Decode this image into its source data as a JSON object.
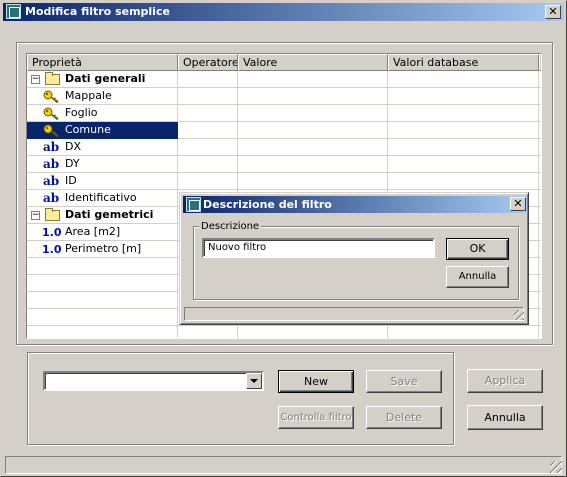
{
  "window": {
    "title": "Modifica filtro semplice"
  },
  "grid": {
    "columns": [
      "Proprietà",
      "Operatore",
      "Valore",
      "Valori database"
    ],
    "rows": [
      {
        "label": "Dati generali",
        "kind": "group",
        "icon": "folder-icon"
      },
      {
        "label": "Mappale",
        "kind": "key",
        "icon": "key-icon"
      },
      {
        "label": "Foglio",
        "kind": "key",
        "icon": "key-icon"
      },
      {
        "label": "Comune",
        "kind": "key",
        "icon": "key-icon",
        "selected": true
      },
      {
        "label": "DX",
        "kind": "text",
        "icon": "text-type-icon"
      },
      {
        "label": "DY",
        "kind": "text",
        "icon": "text-type-icon"
      },
      {
        "label": "ID",
        "kind": "text",
        "icon": "text-type-icon"
      },
      {
        "label": "Identificativo",
        "kind": "text",
        "icon": "text-type-icon"
      },
      {
        "label": "Dati gemetrici",
        "kind": "group",
        "icon": "folder-icon"
      },
      {
        "label": "Area [m2]",
        "kind": "number",
        "icon": "numeric-type-icon"
      },
      {
        "label": "Perimetro [m]",
        "kind": "number",
        "icon": "numeric-type-icon"
      }
    ],
    "text_icon": "ab",
    "number_icon": "1.0",
    "collapse_glyph": "−",
    "selection_color": "#0a246a"
  },
  "controls": {
    "combo_value": "",
    "new_label": "New",
    "save_label": "Save",
    "check_label": "Controlla filtro",
    "delete_label": "Delete",
    "apply_label": "Applica",
    "cancel_label": "Annulla"
  },
  "dialog": {
    "title": "Descrizione del filtro",
    "group_label": "Descrizione",
    "input_value": "Nuovo filtro",
    "ok_label": "OK",
    "cancel_label": "Annulla"
  },
  "close_glyph": "✕"
}
